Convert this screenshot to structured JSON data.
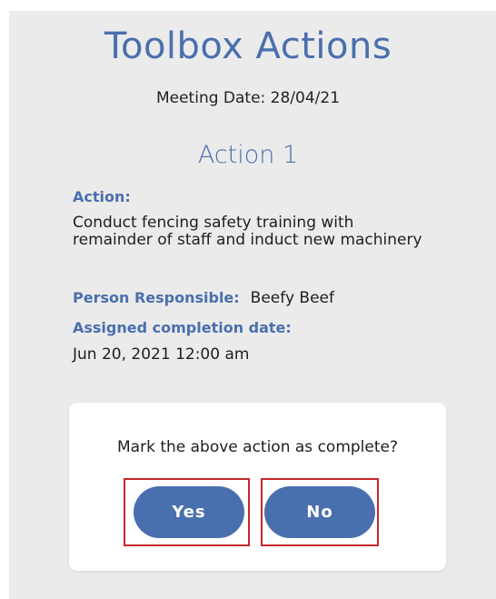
{
  "header": {
    "title": "Toolbox Actions",
    "meeting_date": "Meeting Date: 28/04/21"
  },
  "action": {
    "heading": "Action 1",
    "action_label": "Action:",
    "action_text": "Conduct fencing safety training with remainder of staff and induct new machinery",
    "person_label": "Person Responsible:",
    "person_value": "Beefy Beef",
    "completion_label": "Assigned completion date:",
    "completion_value": "Jun 20, 2021 12:00 am"
  },
  "dialog": {
    "question": "Mark the above action as complete?",
    "yes_label": "Yes",
    "no_label": "No"
  },
  "colors": {
    "accent": "#4a6fae",
    "highlight_border": "#c62828",
    "screen_background": "#ebebeb"
  }
}
